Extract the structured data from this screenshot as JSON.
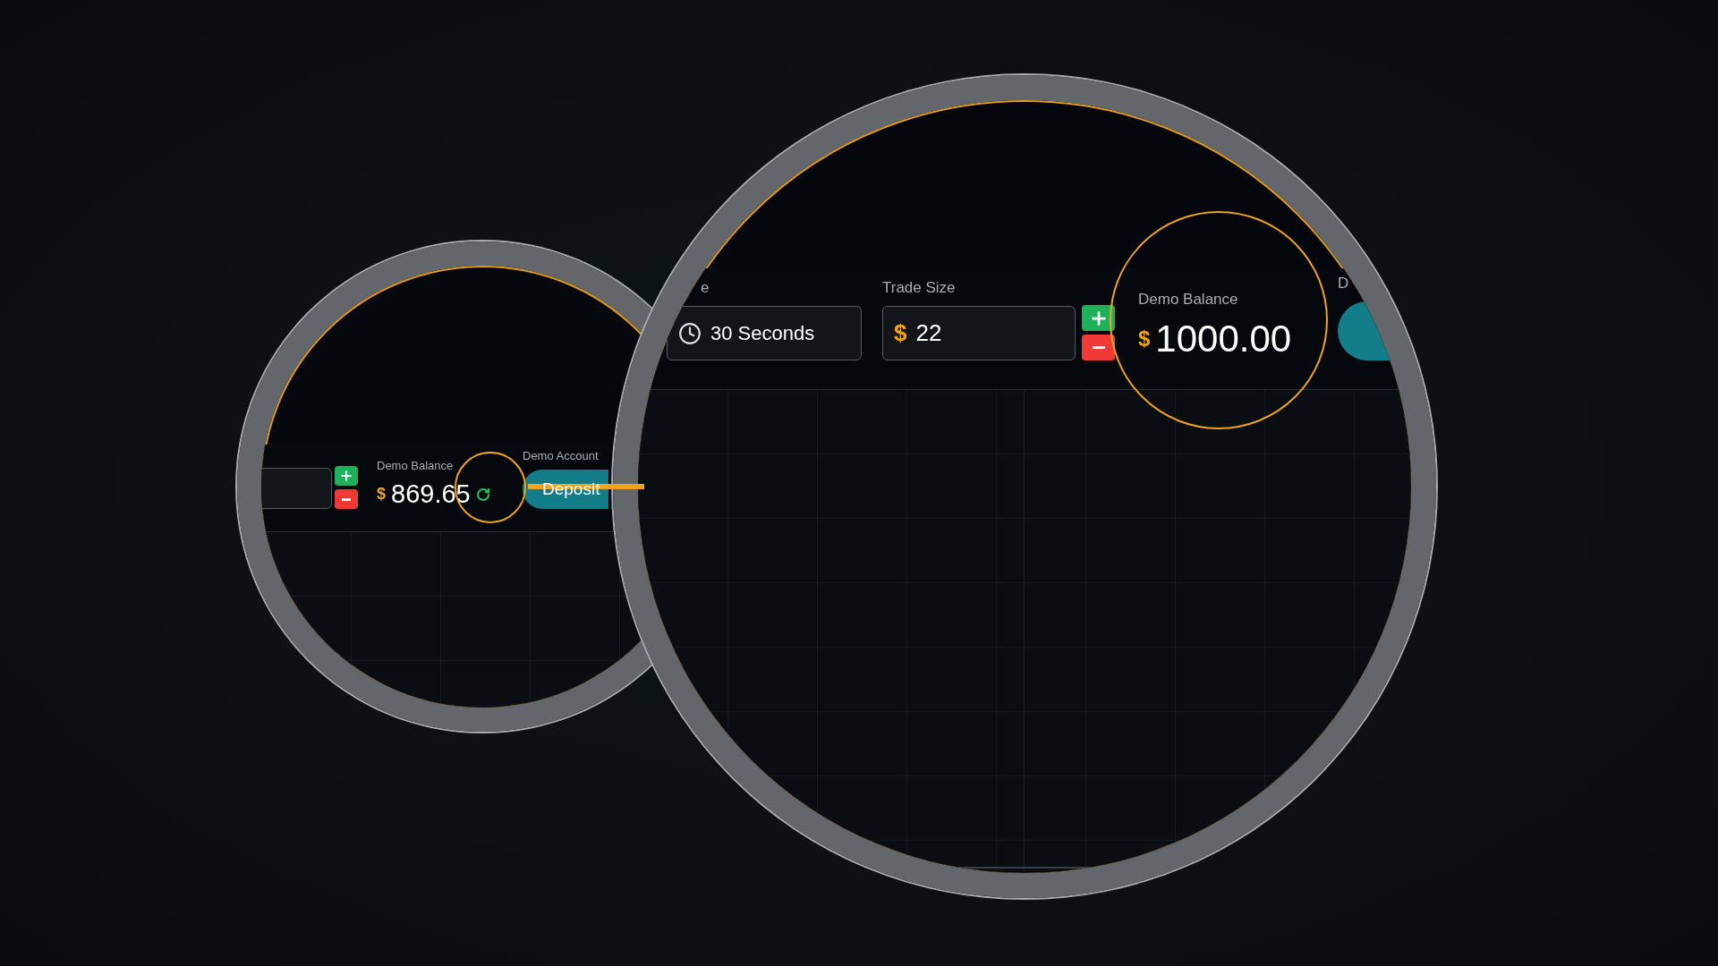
{
  "small_view": {
    "balance": {
      "label": "Demo Balance",
      "currency": "$",
      "value": "869.65"
    },
    "account": {
      "label": "Demo Account",
      "button": "Deposit"
    }
  },
  "large_view": {
    "time": {
      "label": "e",
      "value": "30 Seconds"
    },
    "trade_size": {
      "label": "Trade Size",
      "currency": "$",
      "value": "22"
    },
    "balance": {
      "label": "Demo Balance",
      "currency": "$",
      "value": "1000.00"
    },
    "account": {
      "label": "D"
    }
  }
}
